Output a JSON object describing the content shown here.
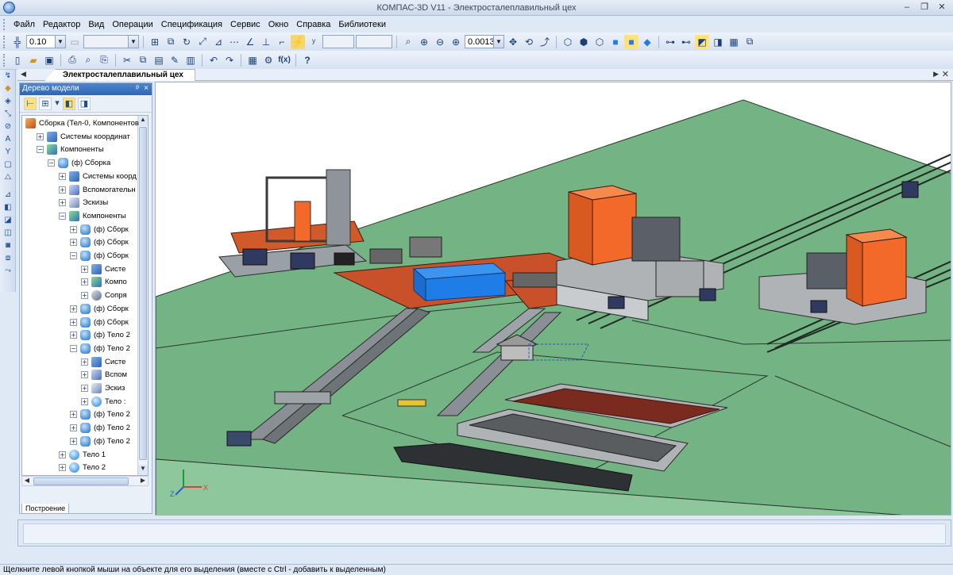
{
  "window": {
    "title": "КОМПАС-3D V11 - Электросталеплавильный цех",
    "icon": "kompas-app-icon",
    "controls": [
      "minimize",
      "restore",
      "close"
    ]
  },
  "menu": {
    "items": [
      "Файл",
      "Редактор",
      "Вид",
      "Операции",
      "Спецификация",
      "Сервис",
      "Окно",
      "Справка",
      "Библиотеки"
    ]
  },
  "toolbar1": {
    "step_value": "0.10",
    "zoom_value": "0.0013",
    "icons": [
      "snap-grid-icon",
      "step-dropdown",
      "layer-combo",
      "local-cs-icon",
      "construct-icon",
      "rotate-icon",
      "scale-icon",
      "mirror-icon",
      "grid-icon",
      "ortho-icon",
      "coordinate-icon",
      "dimension-icon",
      "hide-icon",
      "zoom-window-icon",
      "zoom-in-icon",
      "zoom-out-icon",
      "zoom-scale-icon",
      "pan-icon",
      "rotate-view-icon",
      "orient-icon",
      "wireframe-icon",
      "hidden-lines-icon",
      "thin-lines-icon",
      "shaded-icon",
      "shaded-edges-icon",
      "perspective-icon",
      "filter-icon",
      "select-filter-icon",
      "section-icon",
      "display-icon",
      "model-tree-icon",
      "properties-icon"
    ]
  },
  "toolbar2": {
    "icons": [
      "new-document-icon",
      "open-icon",
      "save-icon",
      "print-icon",
      "print-preview-icon",
      "print-setup-icon",
      "cut-icon",
      "copy-icon",
      "paste-icon",
      "format-painter-icon",
      "library-manager-icon",
      "undo-icon",
      "redo-icon",
      "variables-icon",
      "variables-table-icon",
      "fx-icon",
      "help-icon"
    ]
  },
  "left_toolbar": {
    "icons": [
      "geometry-icon",
      "edit-icon",
      "assembly-icon",
      "snap-icon",
      "select-icon",
      "dimension-icon",
      "surface-icon",
      "array-icon",
      "measure-icon",
      "part-icon",
      "component-icon",
      "spec-icon",
      "report-icon",
      "mate-icon",
      "library-icon",
      "control-icon"
    ]
  },
  "document_tab": {
    "label": "Электросталеплавильный цех"
  },
  "tree_panel": {
    "title": "Дерево модели",
    "pin": "ᵖ",
    "close": "×",
    "tab_label": "Построение",
    "nodes": [
      {
        "level": 0,
        "exp": "",
        "icon": "ico-asm",
        "label": "Сборка (Тел-0, Компонентов"
      },
      {
        "level": 1,
        "exp": "+",
        "icon": "ico-sys",
        "label": "Системы координат"
      },
      {
        "level": 1,
        "exp": "−",
        "icon": "ico-comp",
        "label": "Компоненты"
      },
      {
        "level": 2,
        "exp": "−",
        "icon": "ico-part",
        "label": "(ф) Сборка"
      },
      {
        "level": 3,
        "exp": "+",
        "icon": "ico-sys",
        "label": "Системы коорд"
      },
      {
        "level": 3,
        "exp": "+",
        "icon": "ico-aux",
        "label": "Вспомогательн"
      },
      {
        "level": 3,
        "exp": "+",
        "icon": "ico-sk",
        "label": "Эскизы"
      },
      {
        "level": 3,
        "exp": "−",
        "icon": "ico-comp",
        "label": "Компоненты"
      },
      {
        "level": 4,
        "exp": "+",
        "icon": "ico-part",
        "label": "(ф) Сборк"
      },
      {
        "level": 4,
        "exp": "+",
        "icon": "ico-part",
        "label": "(ф) Сборк"
      },
      {
        "level": 4,
        "exp": "−",
        "icon": "ico-part",
        "label": "(ф) Сборк"
      },
      {
        "level": 5,
        "exp": "+",
        "icon": "ico-sys",
        "label": "Систе"
      },
      {
        "level": 5,
        "exp": "+",
        "icon": "ico-comp",
        "label": "Компо"
      },
      {
        "level": 5,
        "exp": "+",
        "icon": "ico-mate",
        "label": "Сопря"
      },
      {
        "level": 4,
        "exp": "+",
        "icon": "ico-part",
        "label": "(ф) Сборк"
      },
      {
        "level": 4,
        "exp": "+",
        "icon": "ico-part",
        "label": "(ф) Сборк"
      },
      {
        "level": 4,
        "exp": "+",
        "icon": "ico-part",
        "label": "(ф) Тело 2"
      },
      {
        "level": 4,
        "exp": "−",
        "icon": "ico-part",
        "label": "(ф) Тело 2"
      },
      {
        "level": 5,
        "exp": "+",
        "icon": "ico-sys",
        "label": "Систе"
      },
      {
        "level": 5,
        "exp": "+",
        "icon": "ico-aux",
        "label": "Вспом"
      },
      {
        "level": 5,
        "exp": "+",
        "icon": "ico-sk",
        "label": "Эскиз"
      },
      {
        "level": 5,
        "exp": "+",
        "icon": "ico-body",
        "label": "Тело :"
      },
      {
        "level": 4,
        "exp": "+",
        "icon": "ico-part",
        "label": "(ф) Тело 2"
      },
      {
        "level": 4,
        "exp": "+",
        "icon": "ico-part",
        "label": "(ф) Тело 2"
      },
      {
        "level": 4,
        "exp": "+",
        "icon": "ico-part",
        "label": "(ф) Тело 2"
      },
      {
        "level": 3,
        "exp": "+",
        "icon": "ico-body",
        "label": "Тело 1"
      },
      {
        "level": 3,
        "exp": "+",
        "icon": "ico-body",
        "label": "Тело 2"
      }
    ]
  },
  "axes": {
    "x_label": "X",
    "y_label": "Y",
    "z_label": "Z"
  },
  "colors": {
    "floor_green": "#74b383",
    "edge_dark": "#2a3a2e",
    "furnace_orange": "#f2692a",
    "platform_rust": "#c8512a",
    "ladle_blue": "#1e7de6",
    "steel_gray": "#b7b7b7"
  },
  "status": {
    "text": "Щелкните левой кнопкой мыши на объекте для его выделения (вместе с Ctrl - добавить к выделенным)"
  }
}
